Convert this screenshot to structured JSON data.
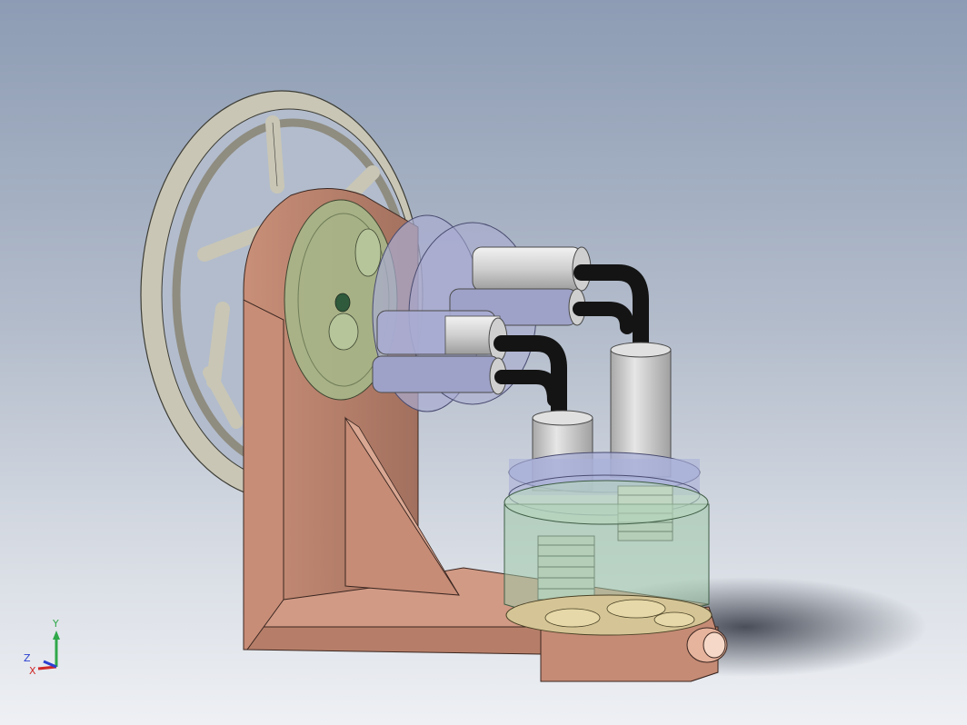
{
  "viewport": {
    "background_top": "#8d9cb4",
    "background_bottom": "#eef0f4"
  },
  "model": {
    "parts": [
      {
        "name": "flywheel",
        "color": "#c9c6b6"
      },
      {
        "name": "frame",
        "color": "#c98f78"
      },
      {
        "name": "crank-disc",
        "color": "#a6b789"
      },
      {
        "name": "cylinder-manifold",
        "color": "#a9acd2"
      },
      {
        "name": "cylinders",
        "color": "#d6d6d6"
      },
      {
        "name": "hoses",
        "color": "#141414"
      },
      {
        "name": "bellows-pistons",
        "color": "#cfd6c9"
      },
      {
        "name": "lower-chamber",
        "color": "#9fc9a8"
      },
      {
        "name": "upper-chamber",
        "color": "#aab0d8"
      },
      {
        "name": "valve-plate",
        "color": "#d5c596"
      },
      {
        "name": "port-fitting",
        "color": "#e6b39c"
      }
    ]
  },
  "triad": {
    "y_label": "Y",
    "z_label": "Z",
    "x_label": "X",
    "colors": {
      "y": "#2fa84a",
      "x": "#d02828",
      "z": "#2a3fd0"
    }
  }
}
